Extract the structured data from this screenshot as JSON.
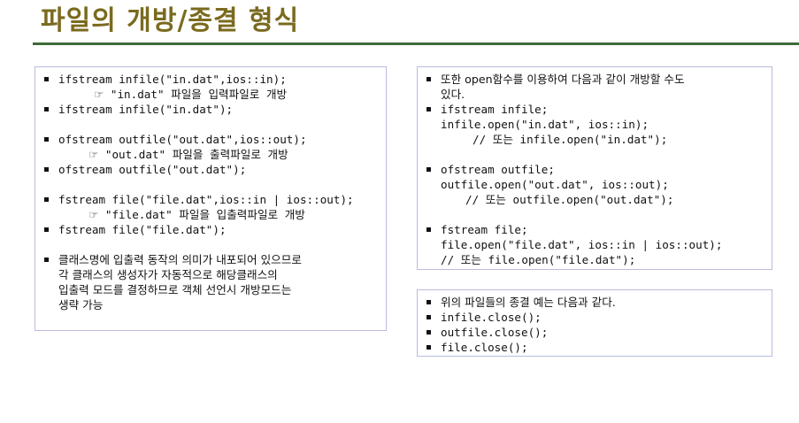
{
  "title": "파일의 개방/종결 형식",
  "left_box": {
    "lines": [
      {
        "bullet": true,
        "indent": 0,
        "text": "ifstream infile(\"in.dat\",ios::in);"
      },
      {
        "bullet": false,
        "indent": 40,
        "pointer": "☞",
        "text": " \"in.dat\" 파일을 입력파일로 개방"
      },
      {
        "bullet": true,
        "indent": 0,
        "text": "ifstream infile(\"in.dat\");"
      },
      {
        "blank": true
      },
      {
        "bullet": true,
        "indent": 0,
        "text": "ofstream outfile(\"out.dat\",ios::out);"
      },
      {
        "bullet": false,
        "indent": 34,
        "pointer": "☞",
        "text": " \"out.dat\" 파일을 출력파일로 개방"
      },
      {
        "bullet": true,
        "indent": 0,
        "text": "ofstream outfile(\"out.dat\");"
      },
      {
        "blank": true
      },
      {
        "bullet": true,
        "indent": 0,
        "text": "fstream file(\"file.dat\",ios::in | ios::out);"
      },
      {
        "bullet": false,
        "indent": 34,
        "pointer": "☞",
        "text": " \"file.dat\" 파일을 입출력파일로 개방"
      },
      {
        "bullet": true,
        "indent": 0,
        "text": "fstream file(\"file.dat\");"
      },
      {
        "blank": true
      },
      {
        "bullet": true,
        "indent": 0,
        "kr": true,
        "text": "클래스명에 입출력 동작의 의미가 내포되어 있으므로"
      },
      {
        "bullet": false,
        "indent": 0,
        "kr": true,
        "text": "각 클래스의 생성자가 자동적으로 해당클래스의"
      },
      {
        "bullet": false,
        "indent": 0,
        "kr": true,
        "text": "입출력 모드를 결정하므로 객체 선언시 개방모드는"
      },
      {
        "bullet": false,
        "indent": 0,
        "kr": true,
        "text": "생략 가능"
      }
    ]
  },
  "right_top_box": {
    "lines": [
      {
        "bullet": true,
        "indent": 0,
        "kr": true,
        "text": "또한 open함수를 이용하여 다음과 같이 개방할 수도"
      },
      {
        "bullet": false,
        "indent": 0,
        "kr": true,
        "text": "있다."
      },
      {
        "bullet": true,
        "indent": 0,
        "text": "ifstream infile;"
      },
      {
        "bullet": false,
        "indent": 0,
        "text": "infile.open(\"in.dat\", ios::in);"
      },
      {
        "bullet": false,
        "indent": 36,
        "text": "// 또는 infile.open(\"in.dat\");"
      },
      {
        "blank": true
      },
      {
        "bullet": true,
        "indent": 0,
        "text": "ofstream outfile;"
      },
      {
        "bullet": false,
        "indent": 0,
        "text": "outfile.open(\"out.dat\", ios::out);"
      },
      {
        "bullet": false,
        "indent": 28,
        "text": "// 또는 outfile.open(\"out.dat\");"
      },
      {
        "blank": true
      },
      {
        "bullet": true,
        "indent": 0,
        "text": "fstream file;"
      },
      {
        "bullet": false,
        "indent": 0,
        "text": "file.open(\"file.dat\", ios::in | ios::out);"
      },
      {
        "bullet": false,
        "indent": 0,
        "text": "// 또는 file.open(\"file.dat\");"
      }
    ]
  },
  "right_bottom_box": {
    "lines": [
      {
        "bullet": true,
        "indent": 0,
        "kr": true,
        "text": "위의 파일들의 종결 예는 다음과 같다."
      },
      {
        "bullet": true,
        "indent": 0,
        "text": "infile.close();"
      },
      {
        "bullet": true,
        "indent": 0,
        "text": "outfile.close();"
      },
      {
        "bullet": true,
        "indent": 0,
        "text": "file.close();"
      }
    ]
  }
}
